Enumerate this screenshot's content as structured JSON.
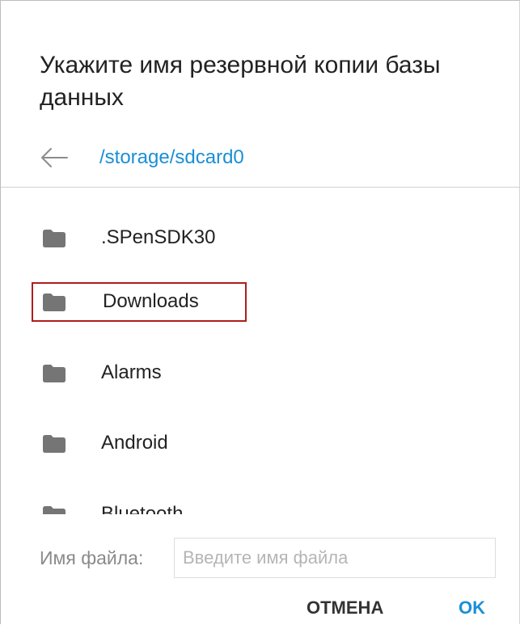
{
  "dialog": {
    "title": "Укажите имя резервной копии базы данных",
    "path": "/storage/sdcard0"
  },
  "folders": [
    {
      "label": ".SPenSDK30",
      "icon": "folder-icon"
    },
    {
      "label": "Downloads",
      "icon": "folder-icon"
    },
    {
      "label": "Alarms",
      "icon": "folder-icon"
    },
    {
      "label": "Android",
      "icon": "folder-icon"
    },
    {
      "label": "Bluetooth",
      "icon": "folder-icon"
    }
  ],
  "filename": {
    "label": "Имя файла:",
    "placeholder": "Введите имя файла",
    "value": ""
  },
  "buttons": {
    "cancel": "ОТМЕНА",
    "ok": "OK"
  },
  "colors": {
    "accent": "#1a8fd6",
    "highlight_border": "#b01c1c",
    "folder": "#757575"
  }
}
